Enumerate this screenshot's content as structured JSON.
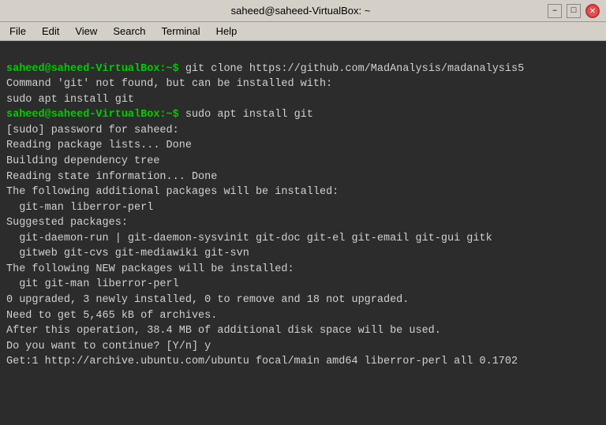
{
  "titlebar": {
    "title": "saheed@saheed-VirtualBox: ~",
    "minimize_label": "–",
    "maximize_label": "□",
    "close_label": "✕"
  },
  "menubar": {
    "items": [
      "File",
      "Edit",
      "View",
      "Search",
      "Terminal",
      "Help"
    ]
  },
  "terminal": {
    "lines": [
      {
        "type": "prompt_cmd",
        "prompt": "saheed@saheed-VirtualBox:~$ ",
        "cmd": "git clone https://github.com/MadAnalysis/madanalysis5"
      },
      {
        "type": "normal",
        "text": ""
      },
      {
        "type": "normal",
        "text": "Command 'git' not found, but can be installed with:"
      },
      {
        "type": "normal",
        "text": ""
      },
      {
        "type": "normal",
        "text": "sudo apt install git"
      },
      {
        "type": "normal",
        "text": ""
      },
      {
        "type": "prompt_cmd",
        "prompt": "saheed@saheed-VirtualBox:~$ ",
        "cmd": "sudo apt install git"
      },
      {
        "type": "normal",
        "text": "[sudo] password for saheed:"
      },
      {
        "type": "normal",
        "text": "Reading package lists... Done"
      },
      {
        "type": "normal",
        "text": "Building dependency tree"
      },
      {
        "type": "normal",
        "text": "Reading state information... Done"
      },
      {
        "type": "normal",
        "text": "The following additional packages will be installed:"
      },
      {
        "type": "normal",
        "text": "  git-man liberror-perl"
      },
      {
        "type": "normal",
        "text": "Suggested packages:"
      },
      {
        "type": "normal",
        "text": "  git-daemon-run | git-daemon-sysvinit git-doc git-el git-email git-gui gitk"
      },
      {
        "type": "normal",
        "text": "  gitweb git-cvs git-mediawiki git-svn"
      },
      {
        "type": "normal",
        "text": "The following NEW packages will be installed:"
      },
      {
        "type": "normal",
        "text": "  git git-man liberror-perl"
      },
      {
        "type": "normal",
        "text": "0 upgraded, 3 newly installed, 0 to remove and 18 not upgraded."
      },
      {
        "type": "normal",
        "text": "Need to get 5,465 kB of archives."
      },
      {
        "type": "normal",
        "text": "After this operation, 38.4 MB of additional disk space will be used."
      },
      {
        "type": "normal",
        "text": "Do you want to continue? [Y/n] y"
      },
      {
        "type": "normal",
        "text": "Get:1 http://archive.ubuntu.com/ubuntu focal/main amd64 liberror-perl all 0.1702"
      }
    ]
  }
}
